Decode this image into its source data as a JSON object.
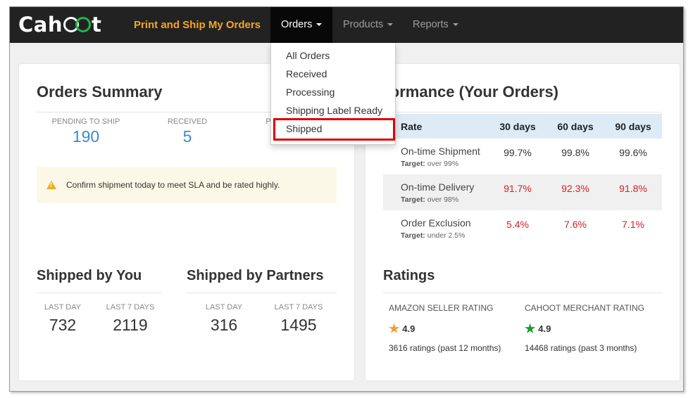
{
  "navbar": {
    "brand": "Print and Ship My Orders",
    "logo_text": "Cahoot",
    "items": [
      {
        "label": "Orders",
        "active": true
      },
      {
        "label": "Products",
        "active": false
      },
      {
        "label": "Reports",
        "active": false
      }
    ]
  },
  "orders_menu": {
    "items": [
      "All Orders",
      "Received",
      "Processing",
      "Shipping Label Ready",
      "Shipped"
    ],
    "highlighted": "Shipped"
  },
  "orders_summary": {
    "title": "Orders Summary",
    "stats": [
      {
        "label": "PENDING TO SHIP",
        "value": "190"
      },
      {
        "label": "RECEIVED",
        "value": "5"
      },
      {
        "label": "PR",
        "value": "..."
      }
    ],
    "alert": "Confirm shipment today to meet SLA and be rated highly."
  },
  "shipped_by_you": {
    "title": "Shipped by You",
    "stats": [
      {
        "label": "LAST DAY",
        "value": "732"
      },
      {
        "label": "LAST 7 DAYS",
        "value": "2119"
      }
    ]
  },
  "shipped_by_partners": {
    "title": "Shipped by Partners",
    "stats": [
      {
        "label": "LAST DAY",
        "value": "316"
      },
      {
        "label": "LAST 7 DAYS",
        "value": "1495"
      }
    ]
  },
  "performance": {
    "title": "Performance (Your Orders)",
    "headers": [
      "Rate",
      "30 days",
      "60 days",
      "90 days"
    ],
    "rows": [
      {
        "name": "On-time Shipment",
        "target_label": "Target:",
        "target": "over 99%",
        "values": [
          "99.7%",
          "99.8%",
          "99.6%"
        ],
        "bad": false
      },
      {
        "name": "On-time Delivery",
        "target_label": "Target:",
        "target": "over 98%",
        "values": [
          "91.7%",
          "92.3%",
          "91.8%"
        ],
        "bad": true
      },
      {
        "name": "Order Exclusion",
        "target_label": "Target:",
        "target": "under 2.5%",
        "values": [
          "5.4%",
          "7.6%",
          "7.1%"
        ],
        "bad": true
      }
    ]
  },
  "ratings": {
    "title": "Ratings",
    "items": [
      {
        "label": "AMAZON SELLER RATING",
        "score": "4.9",
        "count": "3616 ratings (past 12 months)",
        "star_color": "#f0a030"
      },
      {
        "label": "CAHOOT MERCHANT RATING",
        "score": "4.9",
        "count": "14468 ratings (past 3 months)",
        "star_color": "#1a9c2a"
      }
    ]
  },
  "colors": {
    "accent_orange": "#f5a623",
    "stat_blue": "#3a8ad6",
    "bad_red": "#d92020",
    "highlight_red": "#e00000"
  }
}
